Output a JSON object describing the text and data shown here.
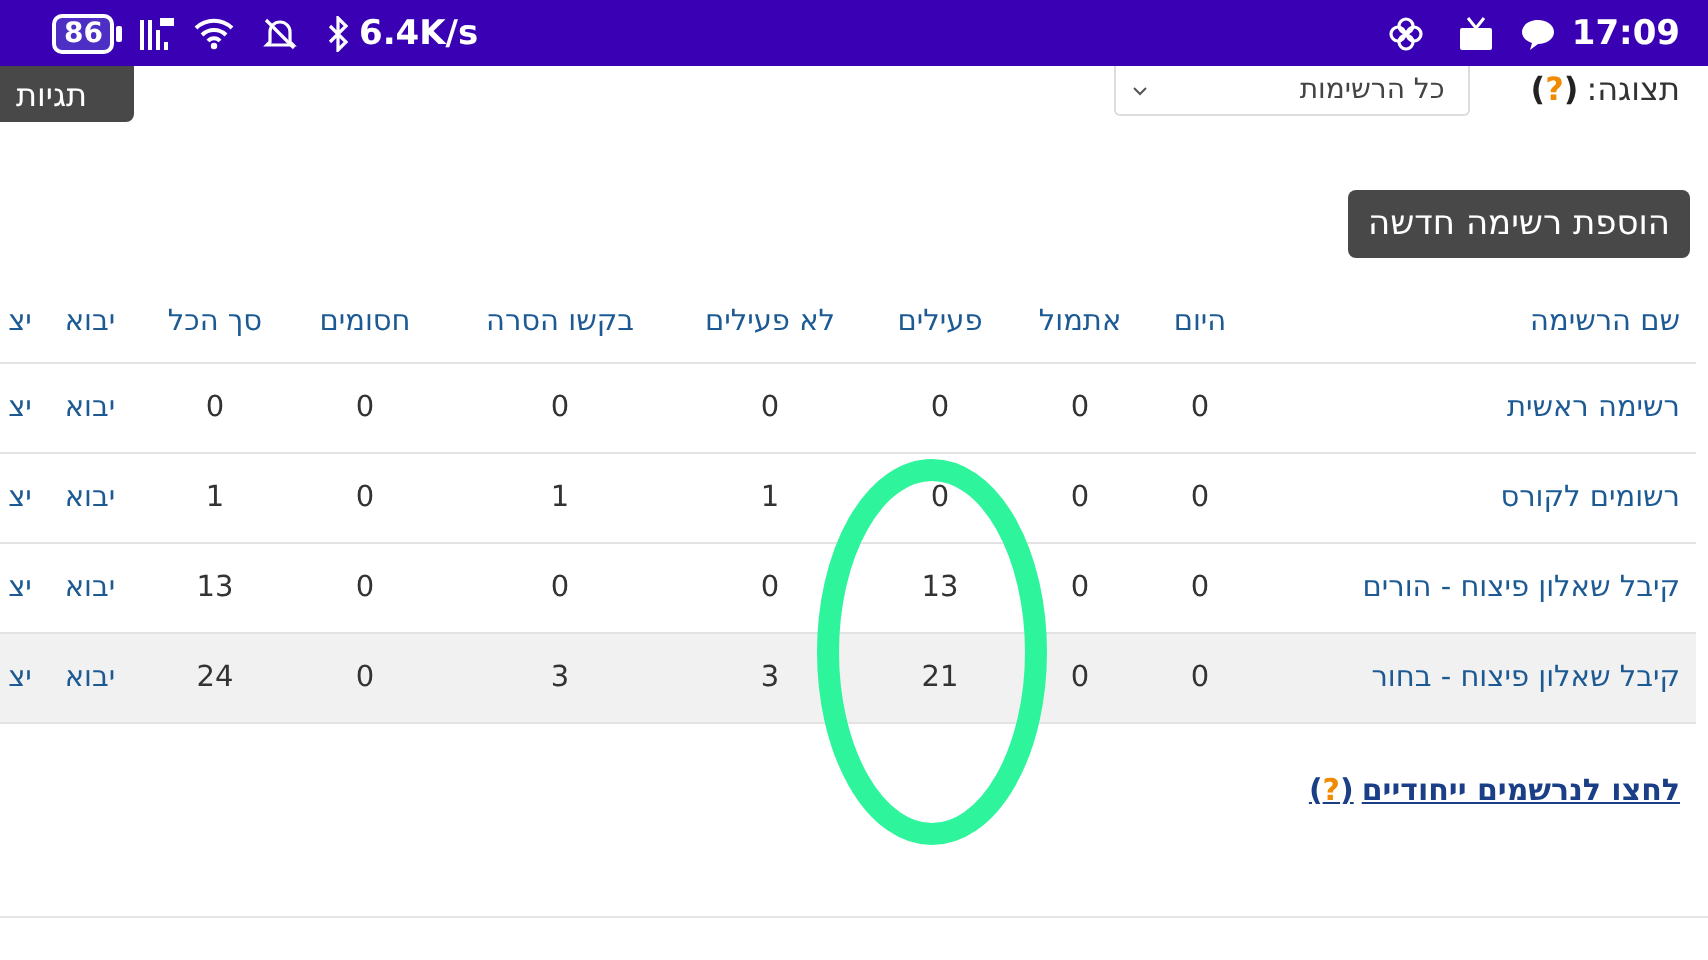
{
  "status_bar": {
    "battery": "86",
    "speed": "6.4K/s",
    "time": "17:09"
  },
  "toolbar": {
    "tags_button": "תגיות",
    "view_label": "תצוגה:",
    "view_help": "(?)",
    "view_select": "כל הרשימות"
  },
  "add_button": "הוספת רשימה חדשה",
  "table": {
    "columns": [
      {
        "label": "שם הרשימה",
        "kind": "link"
      },
      {
        "label": "היום",
        "kind": "count"
      },
      {
        "label": "אתמול",
        "kind": "count"
      },
      {
        "label": "פעילים",
        "kind": "count"
      },
      {
        "label": "לא פעילים",
        "kind": "count"
      },
      {
        "label": "בקשו הסרה",
        "kind": "count"
      },
      {
        "label": "חסומים",
        "kind": "count"
      },
      {
        "label": "סך הכל",
        "kind": "count"
      },
      {
        "label": "יבוא",
        "kind": "link"
      },
      {
        "label": "יצ",
        "kind": "link"
      }
    ],
    "rows": [
      {
        "highlighted": false,
        "cells": [
          "רשימה ראשית",
          "0",
          "0",
          "0",
          "0",
          "0",
          "0",
          "0",
          "יבוא",
          "יצ"
        ]
      },
      {
        "highlighted": false,
        "cells": [
          "רשומים לקורס",
          "0",
          "0",
          "0",
          "1",
          "1",
          "0",
          "1",
          "יבוא",
          "יצ"
        ]
      },
      {
        "highlighted": false,
        "cells": [
          "קיבל שאלון פיצוח - הורים",
          "0",
          "0",
          "13",
          "0",
          "0",
          "0",
          "13",
          "יבוא",
          "יצ"
        ]
      },
      {
        "highlighted": true,
        "cells": [
          "קיבל שאלון פיצוח - בחור",
          "0",
          "0",
          "21",
          "3",
          "3",
          "0",
          "24",
          "יבוא",
          "יצ"
        ]
      }
    ]
  },
  "unique_link": {
    "text": "לחצו לנרשמים ייחודיים",
    "help": "(?)"
  },
  "annotation": {
    "kind": "ellipse"
  }
}
